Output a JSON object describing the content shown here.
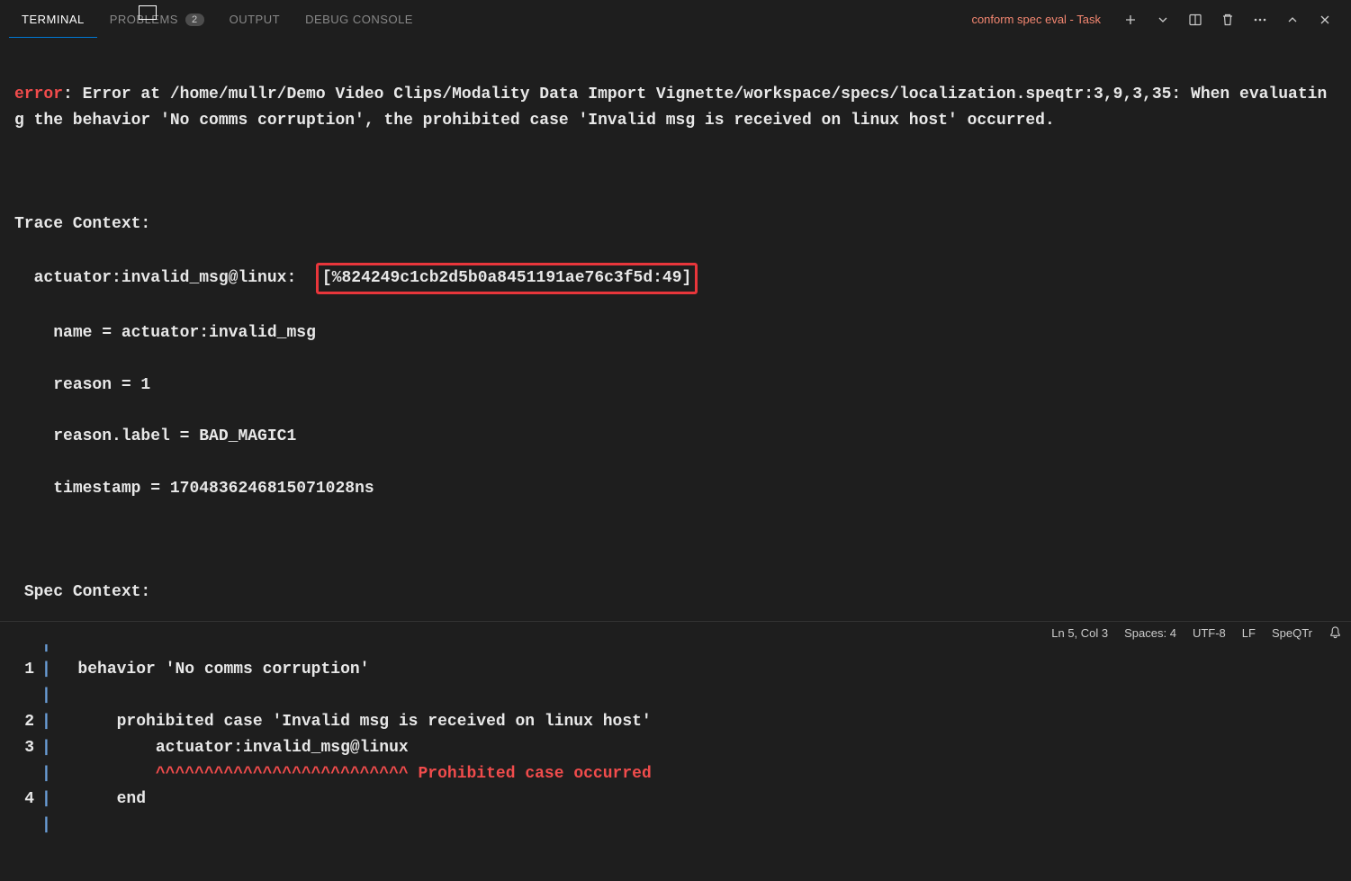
{
  "tabs": {
    "terminal": "TERMINAL",
    "problems": "PROBLEMS",
    "problems_count": "2",
    "output": "OUTPUT",
    "debug_console": "DEBUG CONSOLE"
  },
  "task": {
    "name": "conform spec eval - Task"
  },
  "terminal": {
    "error_label": "error",
    "error_text": ": Error at /home/mullr/Demo Video Clips/Modality Data Import Vignette/workspace/specs/localization.speqtr:3,9,3,35: When evaluating the behavior 'No comms corruption', the prohibited case 'Invalid msg is received on linux host' occurred.",
    "trace_context_header": "Trace Context:",
    "trace_line_prefix": "  actuator:invalid_msg@linux:  ",
    "trace_id": "[%824249c1cb2d5b0a8451191ae76c3f5d:49]",
    "attr_name": "    name = actuator:invalid_msg",
    "attr_reason": "    reason = 1",
    "attr_reason_label": "    reason.label = BAD_MAGIC1",
    "attr_timestamp": "    timestamp = 1704836246815071028ns",
    "spec_context_header": " Spec Context:",
    "spec_lines": [
      {
        "n": "",
        "text": ""
      },
      {
        "n": "1",
        "text": "  behavior 'No comms corruption'"
      },
      {
        "n": "",
        "text": ""
      },
      {
        "n": "2",
        "text": "      prohibited case 'Invalid msg is received on linux host'"
      },
      {
        "n": "3",
        "text": "          actuator:invalid_msg@linux"
      },
      {
        "n": "",
        "carets": "          ^^^^^^^^^^^^^^^^^^^^^^^^^^ ",
        "msg": "Prohibited case occurred"
      },
      {
        "n": "4",
        "text": "      end"
      },
      {
        "n": "",
        "text": ""
      }
    ]
  },
  "status": {
    "position": "Ln 5, Col 3",
    "spaces": "Spaces: 4",
    "encoding": "UTF-8",
    "eol": "LF",
    "language": "SpeQTr"
  }
}
